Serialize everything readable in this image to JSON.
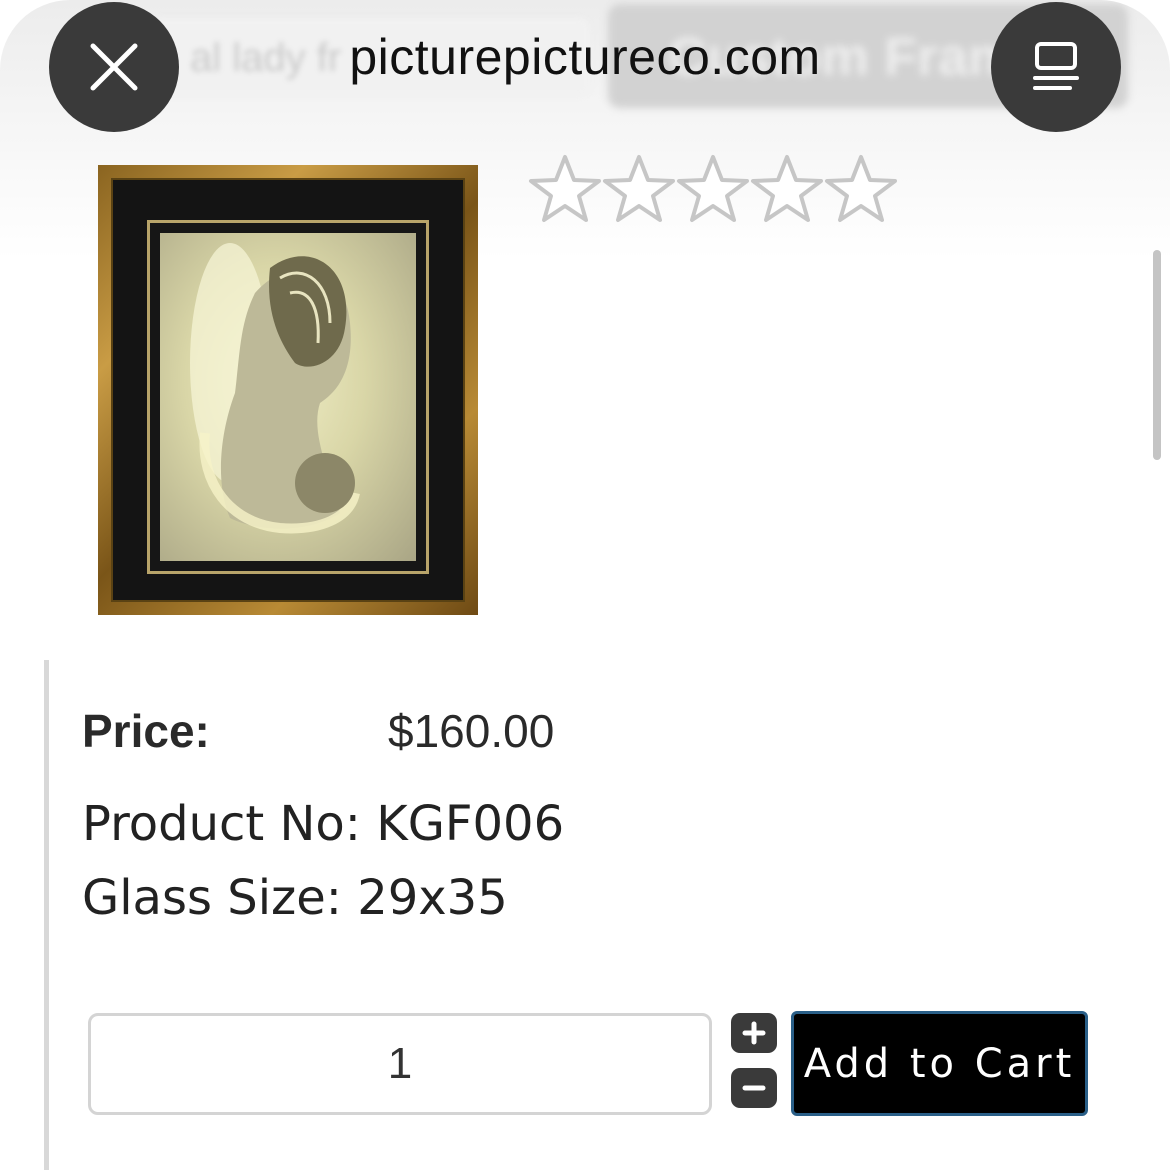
{
  "browser": {
    "url": "picturepictureco.com",
    "close_icon": "close-icon",
    "reader_icon": "reader-mode-icon",
    "background_search_text": "al lady fr",
    "background_button_text": "Custom Frame"
  },
  "product": {
    "image_icon": "framed-artwork-image",
    "rating": {
      "filled": 0,
      "total": 5,
      "icon": "star-outline-icon"
    },
    "price_label": "Price:",
    "price_value": "$160.00",
    "product_no_label": "Product No:",
    "product_no_value": "KGF006",
    "glass_size_label": "Glass Size:",
    "glass_size_value": "29x35"
  },
  "cart": {
    "quantity_value": "1",
    "increment_icon": "plus-icon",
    "decrement_icon": "minus-icon",
    "add_to_cart_label": "Add to Cart"
  },
  "colors": {
    "button_bg": "#000000",
    "button_border": "#2a5f88",
    "round_button_bg": "#3a3a3a"
  }
}
